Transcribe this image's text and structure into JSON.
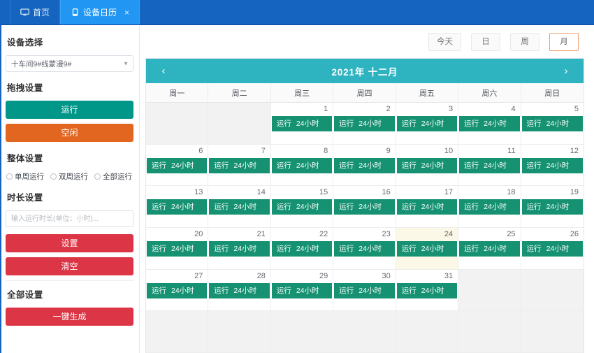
{
  "tabs": [
    {
      "label": "首页",
      "icon": "monitor-icon",
      "active": false,
      "closable": false
    },
    {
      "label": "设备日历",
      "icon": "tablet-icon",
      "active": true,
      "closable": true,
      "close": "×"
    }
  ],
  "sidebar": {
    "device_section_title": "设备选择",
    "device_select_value": "十车间9#线蒙漫9#",
    "drag_section_title": "拖拽设置",
    "run_button": "运行",
    "idle_button": "空闲",
    "overall_section_title": "整体设置",
    "radios": [
      {
        "label": "单周运行",
        "checked": false
      },
      {
        "label": "双周运行",
        "checked": false
      },
      {
        "label": "全部运行",
        "checked": false
      }
    ],
    "duration_section_title": "时长设置",
    "duration_placeholder": "输入运行时长(单位：小时)...",
    "duration_value": "",
    "set_button": "设置",
    "clear_button": "清空",
    "all_section_title": "全部设置",
    "generate_button": "一键生成"
  },
  "viewbar": {
    "today": "今天",
    "day": "日",
    "week": "周",
    "month": "月",
    "selected": "月"
  },
  "calendar": {
    "title": "2021年 十二月",
    "prev_arrow": "‹",
    "next_arrow": "›",
    "weekdays": [
      "周一",
      "周二",
      "周三",
      "周四",
      "周五",
      "周六",
      "周日"
    ],
    "event_label": "运行",
    "event_duration": "24小时",
    "today_date": 24,
    "weeks": [
      [
        {
          "day": null,
          "in_month": false,
          "event": false
        },
        {
          "day": null,
          "in_month": false,
          "event": false
        },
        {
          "day": 1,
          "in_month": true,
          "event": true
        },
        {
          "day": 2,
          "in_month": true,
          "event": true
        },
        {
          "day": 3,
          "in_month": true,
          "event": true
        },
        {
          "day": 4,
          "in_month": true,
          "event": true
        },
        {
          "day": 5,
          "in_month": true,
          "event": true
        }
      ],
      [
        {
          "day": 6,
          "in_month": true,
          "event": true
        },
        {
          "day": 7,
          "in_month": true,
          "event": true
        },
        {
          "day": 8,
          "in_month": true,
          "event": true
        },
        {
          "day": 9,
          "in_month": true,
          "event": true
        },
        {
          "day": 10,
          "in_month": true,
          "event": true
        },
        {
          "day": 11,
          "in_month": true,
          "event": true
        },
        {
          "day": 12,
          "in_month": true,
          "event": true
        }
      ],
      [
        {
          "day": 13,
          "in_month": true,
          "event": true
        },
        {
          "day": 14,
          "in_month": true,
          "event": true
        },
        {
          "day": 15,
          "in_month": true,
          "event": true
        },
        {
          "day": 16,
          "in_month": true,
          "event": true
        },
        {
          "day": 17,
          "in_month": true,
          "event": true
        },
        {
          "day": 18,
          "in_month": true,
          "event": true
        },
        {
          "day": 19,
          "in_month": true,
          "event": true
        }
      ],
      [
        {
          "day": 20,
          "in_month": true,
          "event": true
        },
        {
          "day": 21,
          "in_month": true,
          "event": true
        },
        {
          "day": 22,
          "in_month": true,
          "event": true
        },
        {
          "day": 23,
          "in_month": true,
          "event": true
        },
        {
          "day": 24,
          "in_month": true,
          "event": true,
          "today": true
        },
        {
          "day": 25,
          "in_month": true,
          "event": true
        },
        {
          "day": 26,
          "in_month": true,
          "event": true
        }
      ],
      [
        {
          "day": 27,
          "in_month": true,
          "event": true
        },
        {
          "day": 28,
          "in_month": true,
          "event": true
        },
        {
          "day": 29,
          "in_month": true,
          "event": true
        },
        {
          "day": 30,
          "in_month": true,
          "event": true
        },
        {
          "day": 31,
          "in_month": true,
          "event": true
        },
        {
          "day": null,
          "in_month": false,
          "event": false
        },
        {
          "day": null,
          "in_month": false,
          "event": false
        }
      ],
      [
        {
          "day": null,
          "in_month": false,
          "event": false
        },
        {
          "day": null,
          "in_month": false,
          "event": false
        },
        {
          "day": null,
          "in_month": false,
          "event": false
        },
        {
          "day": null,
          "in_month": false,
          "event": false
        },
        {
          "day": null,
          "in_month": false,
          "event": false
        },
        {
          "day": null,
          "in_month": false,
          "event": false
        },
        {
          "day": null,
          "in_month": false,
          "event": false
        }
      ]
    ]
  },
  "colors": {
    "topbar": "#1565c0",
    "active_tab": "#2196f3",
    "calendar_header": "#2eb3c0",
    "event_green": "#169272",
    "run_button": "#009688",
    "idle_button": "#e2661f",
    "red_button": "#dc3545",
    "today_highlight": "#fcf8e8",
    "selected_view_border": "#f0a070"
  }
}
